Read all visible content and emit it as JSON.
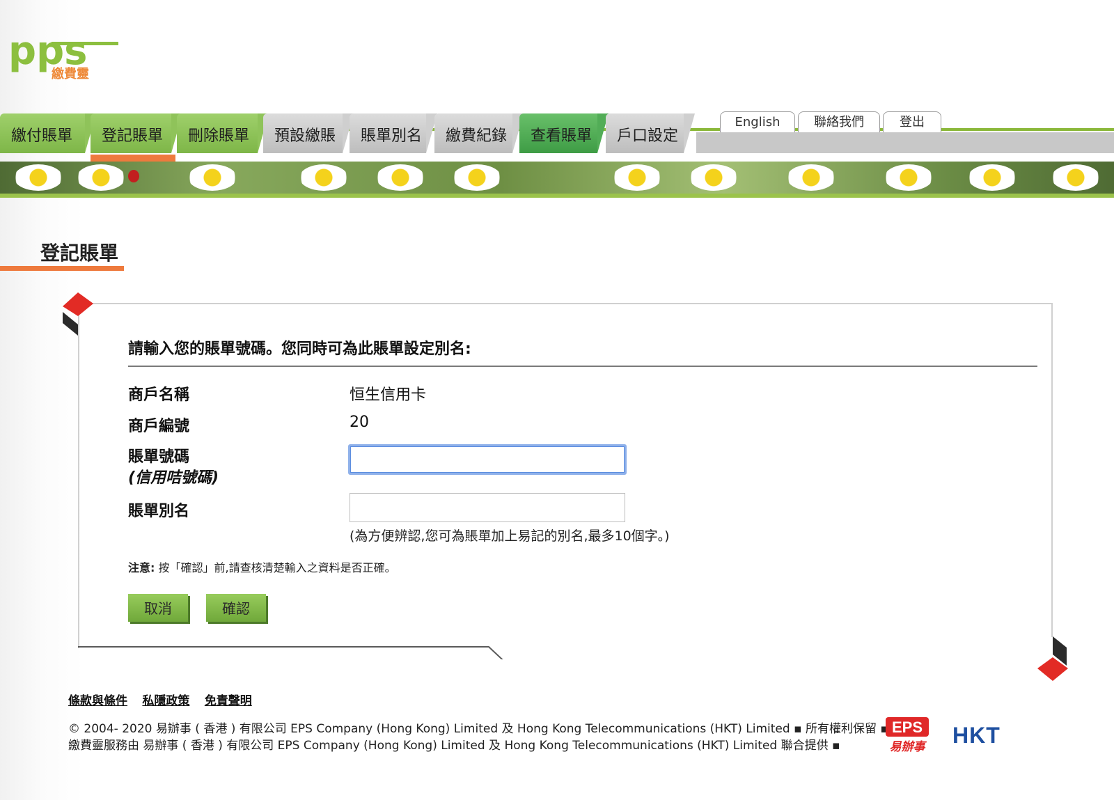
{
  "brand": {
    "logo_text": "pps",
    "logo_subtext": "繳費靈"
  },
  "main_tabs": [
    {
      "label": "繳付賬單"
    },
    {
      "label": "登記賬單"
    },
    {
      "label": "刪除賬單"
    },
    {
      "label": "預設繳賬"
    },
    {
      "label": "賬單別名"
    },
    {
      "label": "繳費紀錄"
    },
    {
      "label": "查看賬單"
    },
    {
      "label": "戶口設定"
    }
  ],
  "util_tabs": [
    {
      "label": "English"
    },
    {
      "label": "聯絡我們"
    },
    {
      "label": "登出"
    }
  ],
  "page": {
    "title": "登記賬單",
    "prompt": "請輸入您的賬單號碼。您同時可為此賬單設定別名:"
  },
  "form": {
    "merchant_name_label": "商戶名稱",
    "merchant_name_value": "恒生信用卡",
    "merchant_no_label": "商戶編號",
    "merchant_no_value": "20",
    "bill_no_label": "賬單號碼",
    "bill_no_sublabel": "(信用咭號碼)",
    "bill_no_value": "",
    "alias_label": "賬單別名",
    "alias_value": "",
    "alias_hint": "(為方便辨認,您可為賬單加上易記的別名,最多10個字。)",
    "note_prefix": "注意:",
    "note_text": " 按「確認」前,請查核清楚輸入之資料是否正確。",
    "cancel_label": "取消",
    "confirm_label": "確認"
  },
  "footer": {
    "links": [
      "條款與條件",
      "私隱政策",
      "免責聲明"
    ],
    "copyright_line1": "© 2004- 2020 易辦事 ( 香港 ) 有限公司 EPS Company (Hong Kong) Limited 及 Hong Kong Telecommunications (HKT) Limited ▪ 所有權利保留 ▪",
    "copyright_line2": "繳費靈服務由 易辦事 ( 香港 ) 有限公司 EPS Company (Hong Kong) Limited 及 Hong Kong Telecommunications (HKT) Limited 聯合提供 ▪",
    "eps_logo_text": "EPS",
    "eps_logo_subtext": "易辦事",
    "hkt_logo_text": "HKT"
  },
  "colors": {
    "tab_green": "#8fc35a",
    "tab_gray": "#c8c8c8",
    "tab_active_bright": "#52ad57",
    "accent_orange": "#ee7a3d",
    "brand_green": "#8bb83a",
    "eps_red": "#e02828",
    "hkt_blue": "#1e4fa0"
  }
}
